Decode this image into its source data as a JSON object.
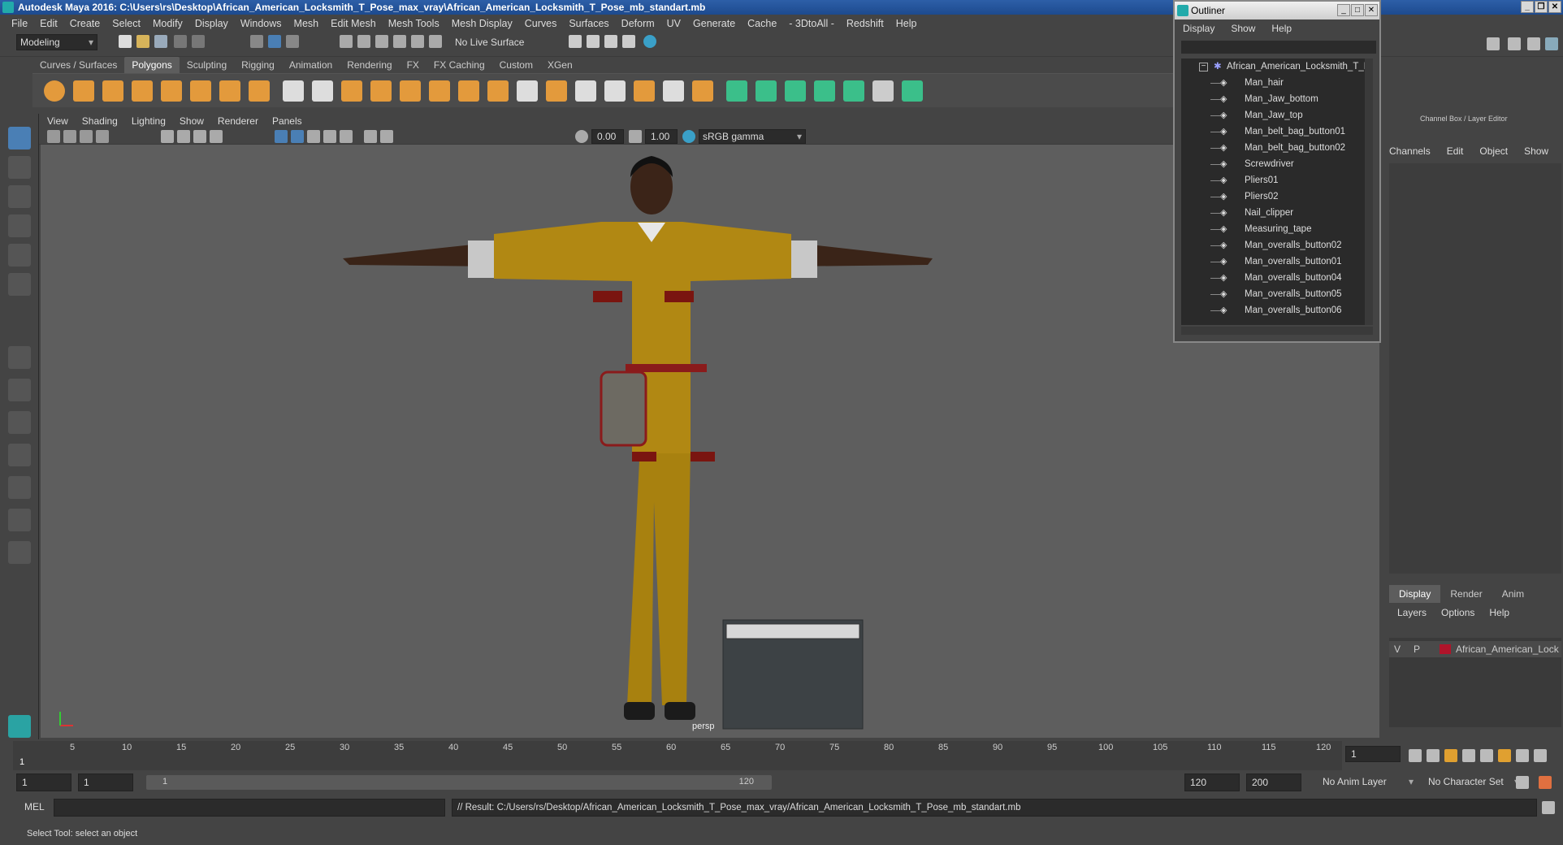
{
  "window": {
    "title": "Autodesk Maya 2016: C:\\Users\\rs\\Desktop\\African_American_Locksmith_T_Pose_max_vray\\African_American_Locksmith_T_Pose_mb_standart.mb"
  },
  "menubar": [
    "File",
    "Edit",
    "Create",
    "Select",
    "Modify",
    "Display",
    "Windows",
    "Mesh",
    "Edit Mesh",
    "Mesh Tools",
    "Mesh Display",
    "Curves",
    "Surfaces",
    "Deform",
    "UV",
    "Generate",
    "Cache",
    "- 3DtoAll -",
    "Redshift",
    "Help"
  ],
  "statusline": {
    "mode": "Modeling",
    "live_surface": "No Live Surface"
  },
  "shelf": {
    "tabs": [
      "Curves / Surfaces",
      "Polygons",
      "Sculpting",
      "Rigging",
      "Animation",
      "Rendering",
      "FX",
      "FX Caching",
      "Custom",
      "XGen"
    ],
    "active": "Polygons"
  },
  "panel": {
    "menu": [
      "View",
      "Shading",
      "Lighting",
      "Show",
      "Renderer",
      "Panels"
    ],
    "exposure": "0.00",
    "gamma": "1.00",
    "colorspace": "sRGB gamma",
    "camera": "persp"
  },
  "outliner": {
    "title": "Outliner",
    "menu": [
      "Display",
      "Show",
      "Help"
    ],
    "root": "African_American_Locksmith_T_Pc",
    "items": [
      "Man_hair",
      "Man_Jaw_bottom",
      "Man_Jaw_top",
      "Man_belt_bag_button01",
      "Man_belt_bag_button02",
      "Screwdriver",
      "Pliers01",
      "Pliers02",
      "Nail_clipper",
      "Measuring_tape",
      "Man_overalls_button02",
      "Man_overalls_button01",
      "Man_overalls_button04",
      "Man_overalls_button05",
      "Man_overalls_button06"
    ]
  },
  "channelbox": {
    "title": "Channel Box / Layer Editor",
    "menu": [
      "Channels",
      "Edit",
      "Object",
      "Show"
    ],
    "layer_tabs": [
      "Display",
      "Render",
      "Anim"
    ],
    "layer_active": "Display",
    "layer_menu": [
      "Layers",
      "Options",
      "Help"
    ],
    "layer": {
      "v": "V",
      "p": "P",
      "name": "African_American_Lock",
      "color": "#b0142a"
    }
  },
  "timeline": {
    "ticks": [
      "5",
      "10",
      "15",
      "20",
      "25",
      "30",
      "35",
      "40",
      "45",
      "50",
      "55",
      "60",
      "65",
      "70",
      "75",
      "80",
      "85",
      "90",
      "95",
      "100",
      "105",
      "110",
      "115",
      "120"
    ],
    "start_marker": "1",
    "current_frame": "1"
  },
  "range": {
    "start": "1",
    "start2": "1",
    "slider_start": "1",
    "slider_end": "120",
    "end": "120",
    "end2": "200",
    "anim_layer": "No Anim Layer",
    "char_set": "No Character Set"
  },
  "commandline": {
    "lang": "MEL",
    "result": "// Result: C:/Users/rs/Desktop/African_American_Locksmith_T_Pose_max_vray/African_American_Locksmith_T_Pose_mb_standart.mb"
  },
  "helpline": "Select Tool: select an object"
}
